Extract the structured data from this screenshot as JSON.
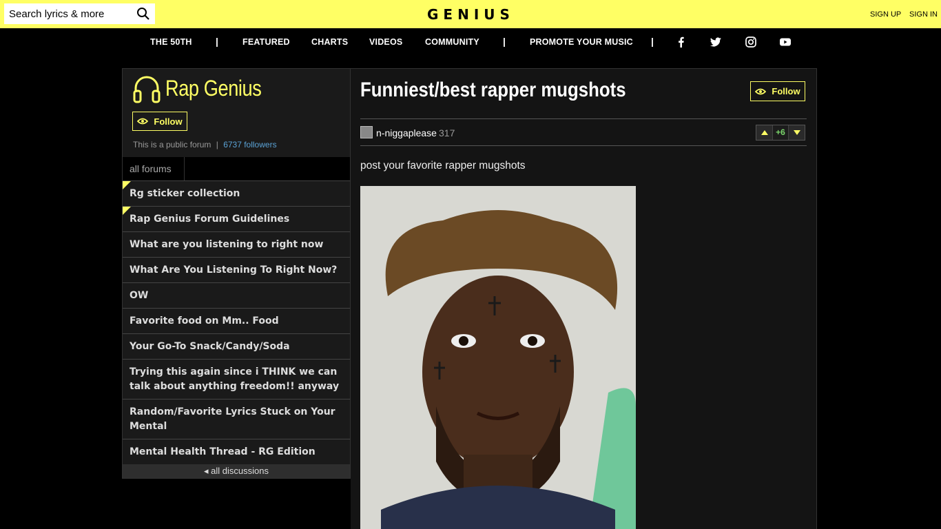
{
  "topbar": {
    "search_placeholder": "Search lyrics & more",
    "logo": "GENIUS",
    "sign_up": "SIGN UP",
    "sign_in": "SIGN IN"
  },
  "nav": {
    "items": [
      "THE 50TH",
      "FEATURED",
      "CHARTS",
      "VIDEOS",
      "COMMUNITY",
      "PROMOTE YOUR MUSIC"
    ],
    "separator": "|",
    "social": [
      "facebook-icon",
      "twitter-icon",
      "instagram-icon",
      "youtube-icon"
    ]
  },
  "forum": {
    "title": "Rap Genius",
    "follow_label": "Follow",
    "info_public": "This is a public forum",
    "info_sep": "|",
    "followers": "6737 followers",
    "tab_all": "all forums",
    "threads": [
      {
        "title": "Rg sticker collection",
        "pinned": true
      },
      {
        "title": "Rap Genius Forum Guidelines",
        "pinned": true
      },
      {
        "title": "What are you listening to right now",
        "pinned": false
      },
      {
        "title": "What Are You Listening To Right Now?",
        "pinned": false
      },
      {
        "title": "OW",
        "pinned": false
      },
      {
        "title": "Favorite food on Mm.. Food",
        "pinned": false
      },
      {
        "title": "Your Go-To Snack/Candy/Soda",
        "pinned": false
      },
      {
        "title": "Trying this again since i THINK we can talk about anything freedom!! anyway",
        "pinned": false
      },
      {
        "title": "Random/Favorite Lyrics Stuck on Your Mental",
        "pinned": false
      },
      {
        "title": "Mental Health Thread - RG Edition",
        "pinned": false
      }
    ],
    "all_discussions": "all discussions"
  },
  "post": {
    "title": "Funniest/best rapper mugshots",
    "follow_label": "Follow",
    "author": "n-niggaplease",
    "author_iq": "317",
    "vote_count": "+6",
    "body": "post your favorite rapper mugshots"
  },
  "colors": {
    "brand_yellow": "#ffff64",
    "link_blue": "#5ba3d6",
    "vote_green": "#7bd66b"
  }
}
